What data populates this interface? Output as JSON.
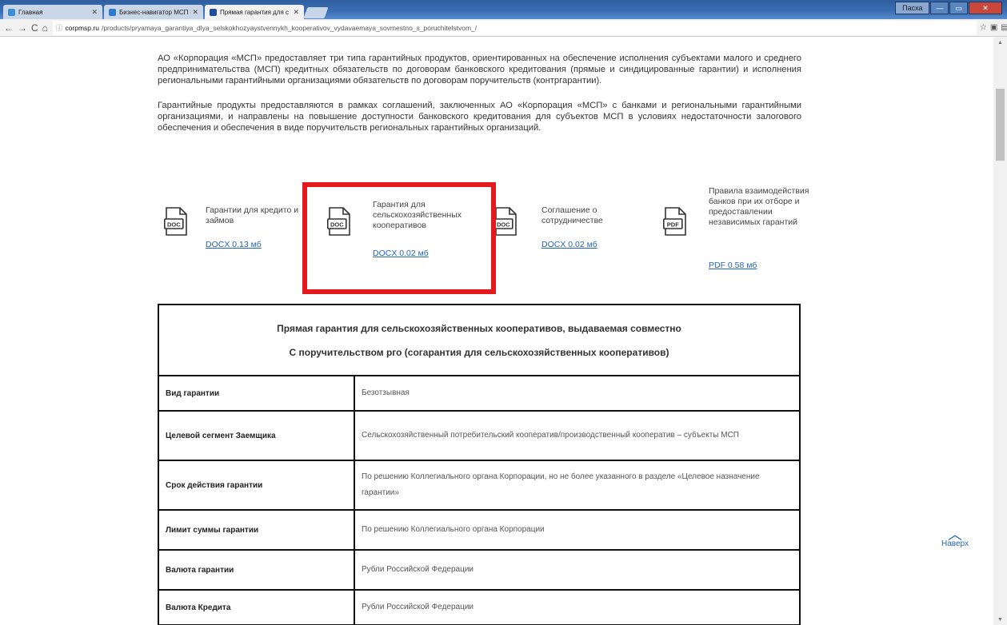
{
  "browser": {
    "tabs": [
      {
        "title": "Главная",
        "color": "#3b8fd6"
      },
      {
        "title": "Бизнес-навигатор МСП",
        "color": "#2b7bd0"
      },
      {
        "title": "Прямая гарантия для с",
        "color": "#1d4f9e"
      }
    ],
    "url_domain": "corpmsp.ru",
    "url_path": "/products/pryamaya_garantiya_dlya_selskokhozyaystvennykh_kooperativov_vydavaemaya_sovmestno_s_poruchitelstvom_/",
    "user_button": "Пасха"
  },
  "intro": {
    "p1": "АО «Корпорация «МСП» предоставляет три типа гарантийных продуктов, ориентированных на обеспечение исполнения субъектами малого и среднего предпринимательства (МСП) кредитных обязательств по договорам банковского кредитования (прямые и синдицированные гарантии) и исполнения региональными гарантийными организациями обязательств по договорам поручительств (контргарантии).",
    "p2": "Гарантийные продукты предоставляются в рамках соглашений, заключенных АО «Корпорация «МСП» с банками и региональными гарантийными организациями, и направлены на повышение доступности банковского кредитования для субъектов МСП в условиях недостаточности залогового обеспечения и обеспечения в виде поручительств региональных гарантийных организаций."
  },
  "documents": [
    {
      "title": "Гарантии для кредито и займов",
      "link": "DOCX 0.13 мб",
      "icon": "doc-file-icon",
      "label": "DOC"
    },
    {
      "title": "Гарантия для сельскохозяйственных кооперативов",
      "link": "DOCX 0.02 мб",
      "icon": "doc-file-icon",
      "label": "DOC"
    },
    {
      "title": "Соглашение о сотрудничестве",
      "link": "DOCX 0.02 мб",
      "icon": "doc-file-icon",
      "label": "DOC"
    },
    {
      "title": "Правила взаимодействия банков при их отборе и предоставлении независимых гарантий",
      "link": "PDF 0.58 мб",
      "icon": "pdf-file-icon",
      "label": "PDF"
    }
  ],
  "table": {
    "header_line1": "Прямая гарантия для сельскохозяйственных кооперативов, выдаваемая совместно",
    "header_line2": "С поручительством рго (согарантия для сельскохозяйственных кооперативов)",
    "rows": [
      {
        "key": "Вид гарантии",
        "value": "Безотзывная"
      },
      {
        "key": "Целевой сегмент Заемщика",
        "value": "Сельскохозяйственный потребительский кооператив/производственный кооператив – субъекты МСП"
      },
      {
        "key": "Срок действия гарантии",
        "value": "По решению Коллегиального органа Корпорации, но не более указанного в разделе «Целевое назначение гарантии»"
      },
      {
        "key": "Лимит суммы гарантии",
        "value": "По решению Коллегиального органа Корпорации"
      },
      {
        "key": "Валюта гарантии",
        "value": "Рубли Российской Федерации"
      },
      {
        "key": "Валюта Кредита",
        "value": "Рубли Российской Федерации"
      }
    ]
  },
  "back_to_top": "Наверх",
  "colors": {
    "link": "#2266b5",
    "highlight": "#e3191b"
  }
}
